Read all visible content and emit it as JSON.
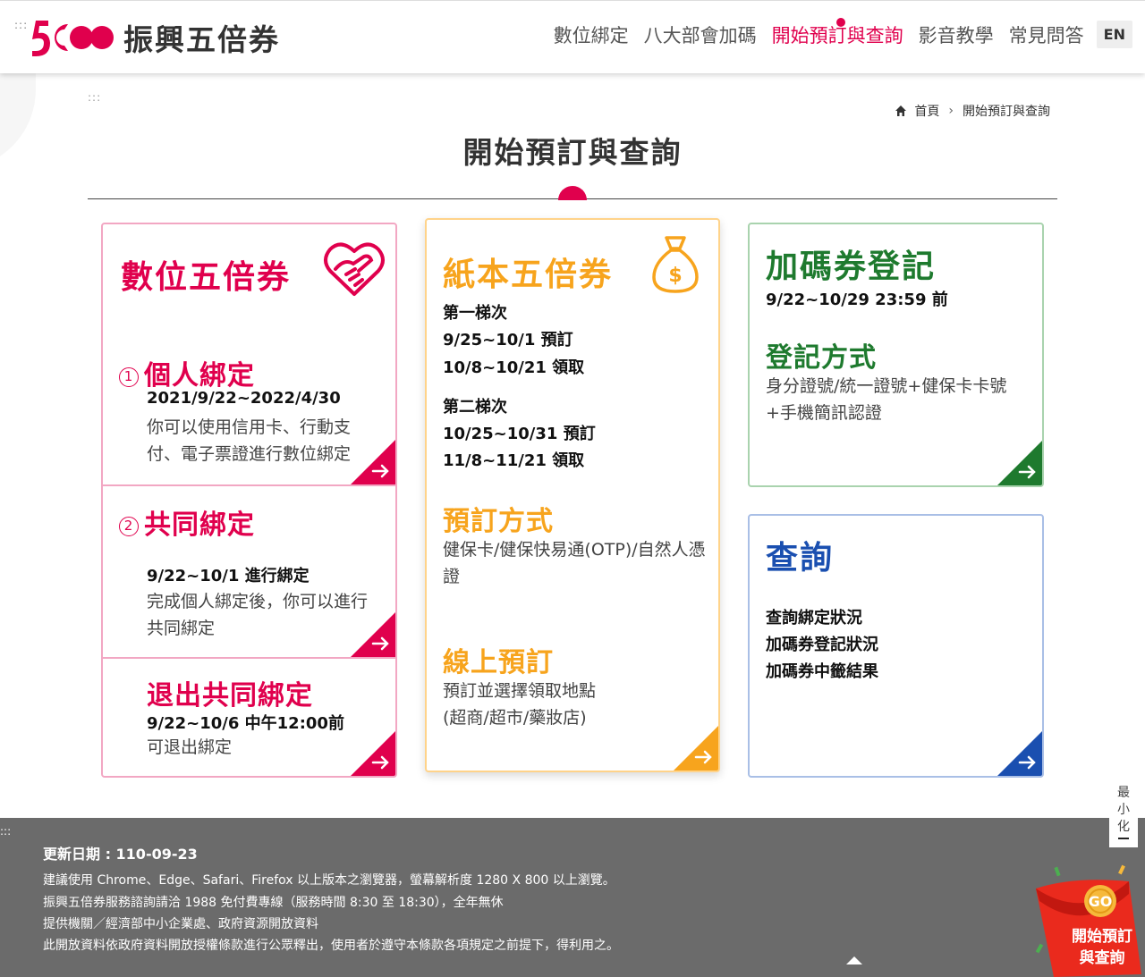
{
  "header": {
    "skip_top": ":::",
    "logo_text": "振興五倍券",
    "nav": [
      {
        "label": "數位綁定"
      },
      {
        "label": "八大部會加碼"
      },
      {
        "label": "開始預訂與查詢"
      },
      {
        "label": "影音教學"
      },
      {
        "label": "常見問答"
      }
    ],
    "lang": "EN"
  },
  "skip_main": ":::",
  "breadcrumb": {
    "home": "首頁",
    "sep": "›",
    "current": "開始預訂與查詢"
  },
  "page_title": "開始預訂與查詢",
  "digital": {
    "title": "數位五倍券",
    "personal": {
      "num": "1",
      "title": "個人綁定",
      "date": "2021/9/22~2022/4/30",
      "desc": "你可以使用信用卡、行動支付、電子票證進行數位綁定"
    },
    "joint": {
      "num": "2",
      "title": "共同綁定",
      "date": "9/22~10/1 進行綁定",
      "desc": "完成個人綁定後，你可以進行共同綁定"
    },
    "exit": {
      "title": "退出共同綁定",
      "date": "9/22~10/6 中午12:00前",
      "desc": "可退出綁定"
    }
  },
  "paper": {
    "title": "紙本五倍券",
    "batch1": {
      "label": "第一梯次",
      "reserve": "9/25~10/1 預訂",
      "pickup": "10/8~10/21 領取"
    },
    "batch2": {
      "label": "第二梯次",
      "reserve": "10/25~10/31 預訂",
      "pickup": "11/8~11/21 領取"
    },
    "method_title": "預訂方式",
    "method_desc": "健保卡/健保快易通(OTP)/自然人憑證",
    "online_title": "線上預訂",
    "online_desc1": "預訂並選擇領取地點",
    "online_desc2": "(超商/超市/藥妝店)"
  },
  "bonus": {
    "title": "加碼券登記",
    "date": "9/22~10/29 23:59 前",
    "method_title": "登記方式",
    "method_desc1": "身分證號/統一證號+健保卡卡號",
    "method_desc2": "+手機簡訊認證"
  },
  "query": {
    "title": "查詢",
    "items": [
      "查詢綁定狀況",
      "加碼券登記狀況",
      "加碼券中籤結果"
    ]
  },
  "footer": {
    "skip": ":::",
    "update": "更新日期 : 110-09-23",
    "lines": [
      "建議使用 Chrome、Edge、Safari、Firefox 以上版本之瀏覽器，螢幕解析度 1280 X 800 以上瀏覽。",
      "振興五倍券服務諮詢請洽 1988 免付費專線（服務時間 8:30 至 18:30），全年無休",
      "提供機關／經濟部中小企業處、政府資源開放資料",
      "此開放資料依政府資料開放授權條款進行公眾釋出，使用者於遵守本條款各項規定之前提下，得利用之。"
    ]
  },
  "minimize": {
    "line1": "最",
    "line2": "小",
    "line3": "化"
  },
  "promo": {
    "go": "GO",
    "line1": "開始預訂",
    "line2": "與查詢"
  },
  "colors": {
    "pink": "#e0004d",
    "orange": "#f7a41d",
    "green": "#1e7a2e",
    "blue": "#1a4fb0"
  }
}
